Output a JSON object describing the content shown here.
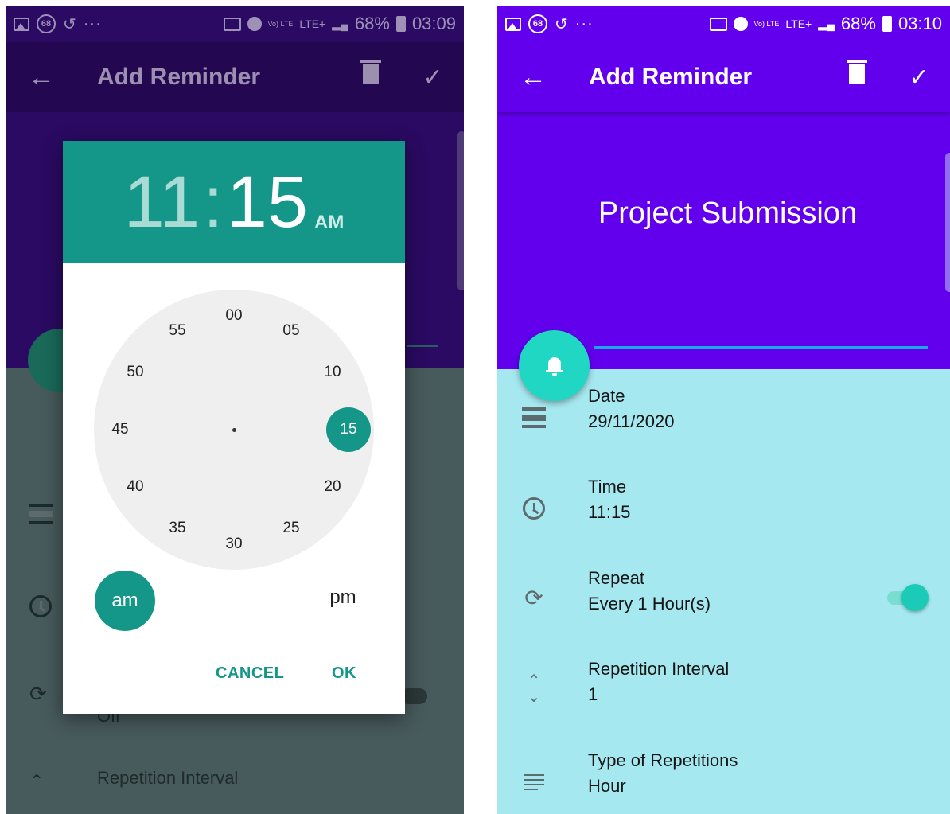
{
  "left_screen": {
    "status_bar": {
      "notif_badge": "68",
      "overflow": "···",
      "network": "LTE+",
      "volte": "Vo) LTE",
      "battery": "68%",
      "clock": "03:09"
    },
    "app_bar": {
      "title": "Add Reminder"
    },
    "background": {
      "repeat_value": "Off",
      "repetition_label": "Repetition Interval"
    },
    "time_picker": {
      "hour": "11",
      "separator": ":",
      "minute": "15",
      "period": "AM",
      "dial_numbers": [
        "00",
        "05",
        "10",
        "15",
        "20",
        "25",
        "30",
        "35",
        "40",
        "45",
        "50",
        "55"
      ],
      "selected_minute": "15",
      "am_label": "am",
      "pm_label": "pm",
      "cancel_label": "CANCEL",
      "ok_label": "OK"
    }
  },
  "right_screen": {
    "status_bar": {
      "notif_badge": "68",
      "overflow": "···",
      "network": "LTE+",
      "volte": "Vo) LTE",
      "battery": "68%",
      "clock": "03:10"
    },
    "app_bar": {
      "title": "Add Reminder"
    },
    "reminder_title": "Project Submission",
    "rows": [
      {
        "label": "Date",
        "value": "29/11/2020",
        "icon": "calendar-icon"
      },
      {
        "label": "Time",
        "value": "11:15",
        "icon": "clock-icon"
      },
      {
        "label": "Repeat",
        "value": "Every 1 Hour(s)",
        "icon": "repeat-icon"
      },
      {
        "label": "Repetition Interval",
        "value": "1",
        "icon": "unfold-icon"
      },
      {
        "label": "Type of Repetitions",
        "value": "Hour",
        "icon": "subject-icon"
      }
    ],
    "repeat_toggle_on": true
  },
  "colors": {
    "purple": "#6200ee",
    "teal": "#149688",
    "accent_fab": "#20d7c4",
    "list_bg": "#a6e8f0"
  }
}
